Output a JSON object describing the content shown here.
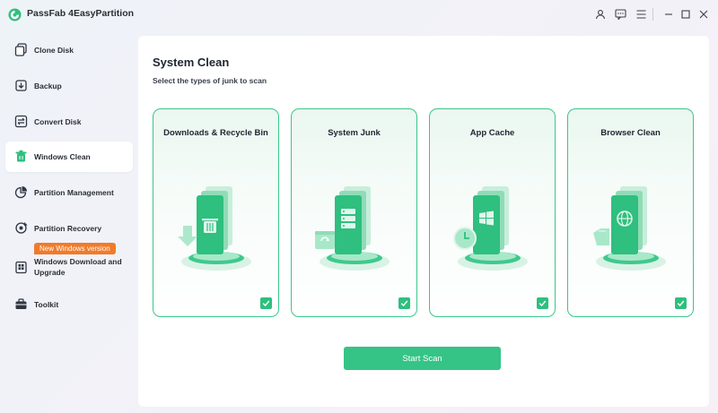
{
  "app": {
    "title": "PassFab 4EasyPartition",
    "brand_color": "#2fbf7f"
  },
  "titlebar_icons": [
    "user-icon",
    "feedback-icon",
    "menu-icon",
    "minimize-icon",
    "maximize-icon",
    "close-icon"
  ],
  "sidebar": {
    "items": [
      {
        "label": "Clone Disk",
        "icon": "clone-disk-icon",
        "active": false
      },
      {
        "label": "Backup",
        "icon": "backup-icon",
        "active": false
      },
      {
        "label": "Convert Disk",
        "icon": "convert-disk-icon",
        "active": false
      },
      {
        "label": "Windows Clean",
        "icon": "trash-icon",
        "active": true
      },
      {
        "label": "Partition Management",
        "icon": "pie-chart-icon",
        "active": false
      },
      {
        "label": "Partition Recovery",
        "icon": "recovery-icon",
        "active": false
      },
      {
        "label": "Windows Download and Upgrade",
        "icon": "windows-download-icon",
        "active": false
      },
      {
        "label": "Toolkit",
        "icon": "toolkit-icon",
        "active": false
      }
    ],
    "badge": "New Windows version"
  },
  "main": {
    "title": "System Clean",
    "subtitle": "Select the types of junk to scan",
    "cards": [
      {
        "title": "Downloads & Recycle Bin",
        "icon": "recycle-bin-illustration",
        "checked": true
      },
      {
        "title": "System Junk",
        "icon": "system-junk-illustration",
        "checked": true
      },
      {
        "title": "App Cache",
        "icon": "app-cache-illustration",
        "checked": true
      },
      {
        "title": "Browser Clean",
        "icon": "browser-clean-illustration",
        "checked": true
      }
    ],
    "start_button": "Start Scan"
  }
}
